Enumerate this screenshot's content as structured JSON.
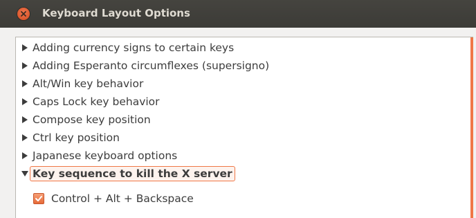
{
  "window": {
    "title": "Keyboard Layout Options"
  },
  "tree": {
    "items": [
      {
        "label": "Adding currency signs to certain keys",
        "expanded": false
      },
      {
        "label": "Adding Esperanto circumflexes (supersigno)",
        "expanded": false
      },
      {
        "label": "Alt/Win key behavior",
        "expanded": false
      },
      {
        "label": "Caps Lock key behavior",
        "expanded": false
      },
      {
        "label": "Compose key position",
        "expanded": false
      },
      {
        "label": "Ctrl key position",
        "expanded": false
      },
      {
        "label": "Japanese keyboard options",
        "expanded": false
      },
      {
        "label": "Key sequence to kill the X server",
        "expanded": true,
        "selected": true
      }
    ],
    "options": [
      {
        "label": "Control + Alt + Backspace",
        "checked": true
      }
    ]
  },
  "colors": {
    "accent": "#f07746",
    "titlebar": "#3c3b37",
    "title_text": "#dfdbd2"
  }
}
